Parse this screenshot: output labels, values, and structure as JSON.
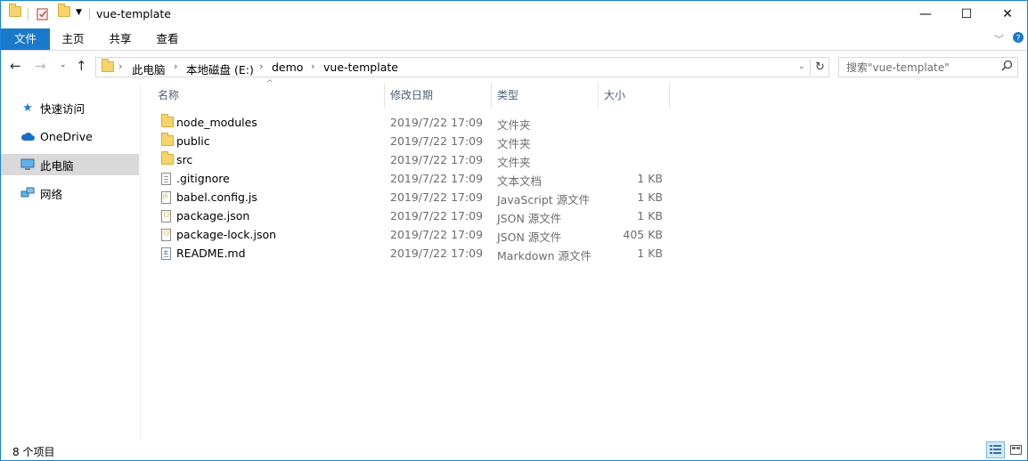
{
  "title": {
    "window_title": "vue-template",
    "minimize_glyph": "—",
    "maximize_glyph": "☐",
    "close_glyph": "✕"
  },
  "ribbon": {
    "tabs": [
      "文件",
      "主页",
      "共享",
      "查看"
    ]
  },
  "address": {
    "crumbs": [
      "此电脑",
      "本地磁盘 (E:)",
      "demo",
      "vue-template"
    ],
    "search_placeholder": "搜索\"vue-template\""
  },
  "navpane": {
    "items": [
      {
        "label": "快速访问",
        "icon": "star-icon"
      },
      {
        "label": "OneDrive",
        "icon": "cloud-icon"
      },
      {
        "label": "此电脑",
        "icon": "computer-icon"
      },
      {
        "label": "网络",
        "icon": "network-icon"
      }
    ]
  },
  "filelist": {
    "columns": [
      "名称",
      "修改日期",
      "类型",
      "大小"
    ],
    "rows": [
      {
        "name": "node_modules",
        "date": "2019/7/22 17:09",
        "type": "文件夹",
        "size": "",
        "icon": "folder-icon"
      },
      {
        "name": "public",
        "date": "2019/7/22 17:09",
        "type": "文件夹",
        "size": "",
        "icon": "folder-icon"
      },
      {
        "name": "src",
        "date": "2019/7/22 17:09",
        "type": "文件夹",
        "size": "",
        "icon": "folder-icon"
      },
      {
        "name": ".gitignore",
        "date": "2019/7/22 17:09",
        "type": "文本文档",
        "size": "1 KB",
        "icon": "text-file-icon"
      },
      {
        "name": "babel.config.js",
        "date": "2019/7/22 17:09",
        "type": "JavaScript 源文件",
        "size": "1 KB",
        "icon": "js-file-icon"
      },
      {
        "name": "package.json",
        "date": "2019/7/22 17:09",
        "type": "JSON 源文件",
        "size": "1 KB",
        "icon": "json-file-icon"
      },
      {
        "name": "package-lock.json",
        "date": "2019/7/22 17:09",
        "type": "JSON 源文件",
        "size": "405 KB",
        "icon": "json-file-icon"
      },
      {
        "name": "README.md",
        "date": "2019/7/22 17:09",
        "type": "Markdown 源文件",
        "size": "1 KB",
        "icon": "markdown-file-icon"
      }
    ]
  },
  "status": {
    "item_count": "8 个项目"
  },
  "colors": {
    "accent": "#1979ca",
    "folder": "#f6d46b",
    "header_text": "#4c607a"
  }
}
